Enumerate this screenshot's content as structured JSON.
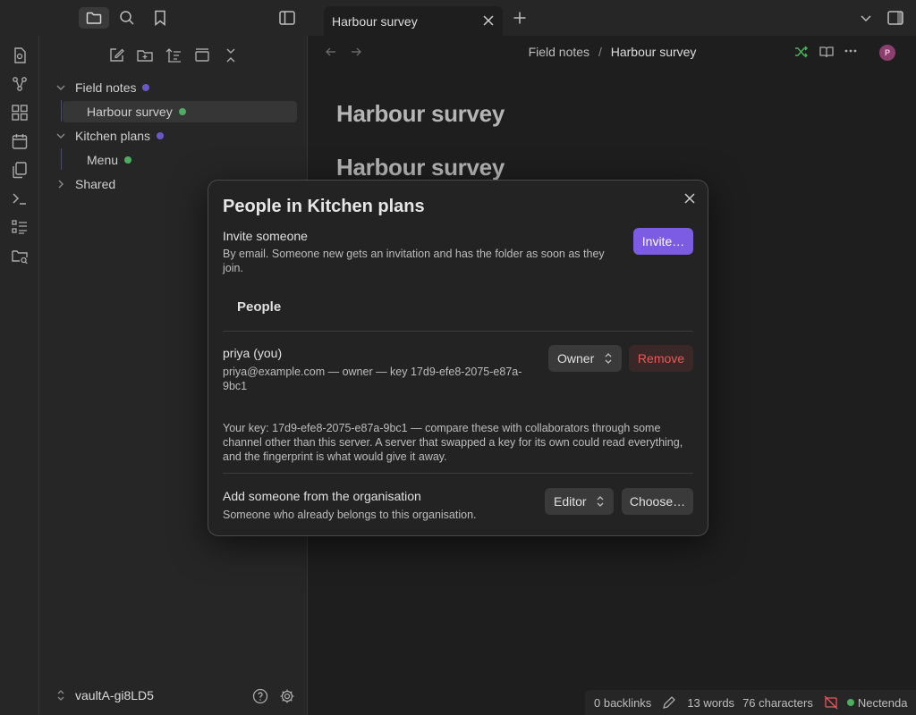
{
  "tab": {
    "title": "Harbour survey"
  },
  "sidebar": {
    "tree": [
      {
        "label": "Field notes",
        "dot": "#6b58c8"
      },
      {
        "label": "Harbour survey",
        "dot": "#4caf60"
      },
      {
        "label": "Kitchen plans",
        "dot": "#6b58c8"
      },
      {
        "label": "Menu",
        "dot": "#4caf60"
      },
      {
        "label": "Shared"
      }
    ],
    "vault_name": "vaultA-gi8LD5"
  },
  "editor": {
    "breadcrumb_parent": "Field notes",
    "breadcrumb_sep": "/",
    "breadcrumb_current": "Harbour survey",
    "heading1": "Harbour survey",
    "heading2": "Harbour survey",
    "avatar_initial": "P"
  },
  "modal": {
    "title": "People in Kitchen plans",
    "invite_label": "Invite someone",
    "invite_desc": "By email. Someone new gets an invitation and has the folder as soon as they join.",
    "invite_button": "Invite…",
    "people_heading": "People",
    "member_name": "priya (you)",
    "member_detail": "priya@example.com — owner — key 17d9-efe8-2075-e87a-9bc1",
    "member_role": "Owner",
    "remove_button": "Remove",
    "key_note": "Your key: 17d9-efe8-2075-e87a-9bc1 — compare these with collaborators through some channel other than this server. A server that swapped a key for its own could read everything, and the fingerprint is what would give it away.",
    "add_label": "Add someone from the organisation",
    "add_desc": "Someone who already belongs to this organisation.",
    "add_role": "Editor",
    "choose_button": "Choose…"
  },
  "status": {
    "backlinks": "0 backlinks",
    "words": "13 words",
    "characters": "76 characters",
    "sync_name": "Nectenda"
  },
  "colors": {
    "accent": "#7b5ce3",
    "danger": "#e8585a",
    "ok": "#4caf60",
    "purple_dot": "#6b58c8"
  }
}
